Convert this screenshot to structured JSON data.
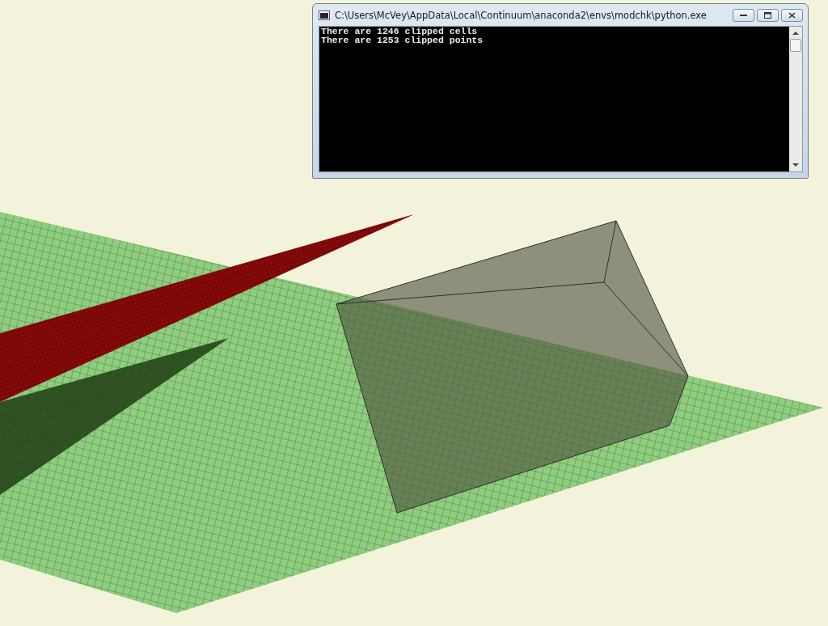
{
  "console_window": {
    "title": "C:\\Users\\McVey\\AppData\\Local\\Continuum\\anaconda2\\envs\\modchk\\python.exe",
    "output_lines": [
      "There are 1246 clipped cells",
      "There are 1253 clipped points"
    ]
  }
}
